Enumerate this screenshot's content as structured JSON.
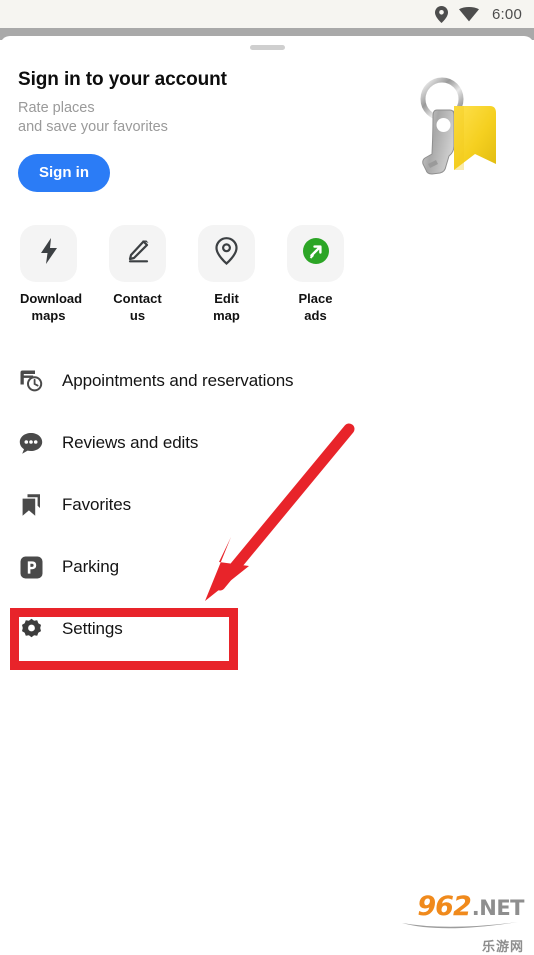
{
  "status_bar": {
    "time": "6:00",
    "icons": [
      "location-pin-icon",
      "wifi-icon"
    ]
  },
  "sheet": {
    "handle": "drag-handle"
  },
  "signin": {
    "title": "Sign in to your account",
    "subtitle_line1": "Rate places",
    "subtitle_line2": "and save your favorites",
    "button_label": "Sign in",
    "button_color": "#2b7cf6",
    "illustration": "keys-with-yellow-tag-image"
  },
  "quick_actions": [
    {
      "label_line1": "Download",
      "label_line2": "maps",
      "icon": "lightning-bolt-icon"
    },
    {
      "label_line1": "Contact",
      "label_line2": "us",
      "icon": "pencil-icon"
    },
    {
      "label_line1": "Edit",
      "label_line2": "map",
      "icon": "map-pin-icon"
    },
    {
      "label_line1": "Place",
      "label_line2": "ads",
      "icon": "green-arrow-circle-icon"
    }
  ],
  "menu_items": [
    {
      "label": "Appointments and reservations",
      "icon": "calendar-clock-icon"
    },
    {
      "label": "Reviews and edits",
      "icon": "chat-bubble-icon"
    },
    {
      "label": "Favorites",
      "icon": "bookmarks-icon"
    },
    {
      "label": "Parking",
      "icon": "parking-p-icon"
    },
    {
      "label": "Settings",
      "icon": "gear-icon"
    }
  ],
  "annotations": {
    "highlight_color": "#e8242a",
    "highlight_target": "Settings",
    "arrow_color": "#e8242a"
  },
  "watermark": {
    "number": "962",
    "domain": ".NET",
    "chinese": "乐游网",
    "number_color": "#f08a1c",
    "text_color": "#8e8e8e"
  }
}
